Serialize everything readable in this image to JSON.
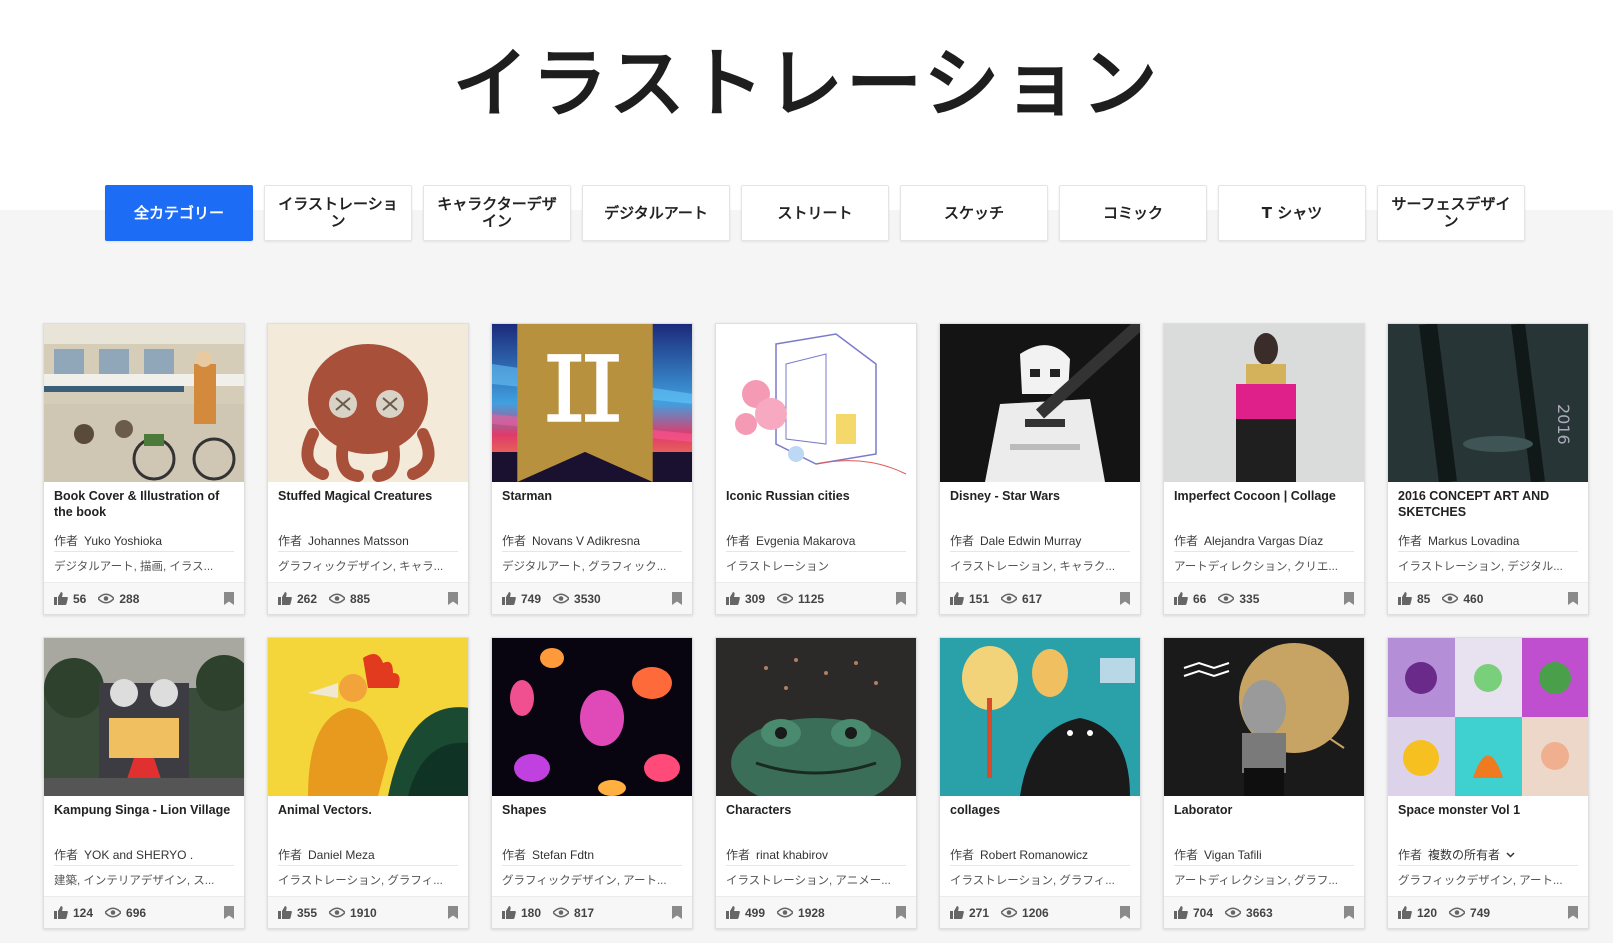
{
  "page": {
    "title": "イラストレーション",
    "author_label": "作者"
  },
  "categories": [
    {
      "label": "全カテゴリー",
      "active": true
    },
    {
      "label": "イラストレーション",
      "active": false
    },
    {
      "label": "キャラクターデザイン",
      "active": false
    },
    {
      "label": "デジタルアート",
      "active": false
    },
    {
      "label": "ストリート",
      "active": false
    },
    {
      "label": "スケッチ",
      "active": false
    },
    {
      "label": "コミック",
      "active": false
    },
    {
      "label": "T シャツ",
      "active": false
    },
    {
      "label": "サーフェスデザイン",
      "active": false
    }
  ],
  "icons": {
    "like": "thumbs-up-icon",
    "views": "eye-icon",
    "save": "bookmark-icon",
    "badge": "featured-badge-icon",
    "dropdown": "chevron-down-icon"
  },
  "colors": {
    "accent": "#1d6cf6",
    "badge": "#b8913f"
  },
  "cards": [
    {
      "title": "Book Cover & Illustration of the book",
      "author": "Yuko Yoshioka",
      "tags": "デジタルアート, 描画, イラス...",
      "likes": "56",
      "views": "288",
      "art": "cafe"
    },
    {
      "title": "Stuffed Magical Creatures",
      "author": "Johannes Matsson",
      "tags": "グラフィックデザイン, キャラ...",
      "likes": "262",
      "views": "885",
      "art": "creature"
    },
    {
      "title": "Starman",
      "author": "Novans V Adikresna",
      "tags": "デジタルアート, グラフィック...",
      "likes": "749",
      "views": "3530",
      "art": "starman",
      "badge": true
    },
    {
      "title": "Iconic Russian cities",
      "author": "Evgenia Makarova",
      "tags": "イラストレーション",
      "likes": "309",
      "views": "1125",
      "art": "russian"
    },
    {
      "title": "Disney - Star Wars",
      "author": "Dale Edwin Murray",
      "tags": "イラストレーション, キャラク...",
      "likes": "151",
      "views": "617",
      "art": "trooper"
    },
    {
      "title": "Imperfect Cocoon | Collage",
      "author": "Alejandra Vargas Díaz",
      "tags": "アートディレクション, クリエ...",
      "likes": "66",
      "views": "335",
      "art": "cocoon"
    },
    {
      "title": "2016 CONCEPT ART AND SKETCHES",
      "author": "Markus Lovadina",
      "tags": "イラストレーション, デジタル...",
      "likes": "85",
      "views": "460",
      "art": "concept"
    },
    {
      "title": "Kampung Singa - Lion Village",
      "author": "YOK and SHERYO .",
      "tags": "建築, インテリアデザイン, ス...",
      "likes": "124",
      "views": "696",
      "art": "kampung"
    },
    {
      "title": "Animal Vectors.",
      "author": "Daniel Meza",
      "tags": "イラストレーション, グラフィ...",
      "likes": "355",
      "views": "1910",
      "art": "rooster"
    },
    {
      "title": "Shapes",
      "author": "Stefan Fdtn",
      "tags": "グラフィックデザイン, アート...",
      "likes": "180",
      "views": "817",
      "art": "shapes"
    },
    {
      "title": "Characters",
      "author": "rinat khabirov",
      "tags": "イラストレーション, アニメー...",
      "likes": "499",
      "views": "1928",
      "art": "frog"
    },
    {
      "title": "collages",
      "author": "Robert Romanowicz",
      "tags": "イラストレーション, グラフィ...",
      "likes": "271",
      "views": "1206",
      "art": "collage"
    },
    {
      "title": "Laborator",
      "author": "Vigan Tafili",
      "tags": "アートディレクション, グラフ...",
      "likes": "704",
      "views": "3663",
      "art": "laborator"
    },
    {
      "title": "Space monster Vol 1",
      "author": "複数の所有者",
      "tags": "グラフィックデザイン, アート...",
      "likes": "120",
      "views": "749",
      "art": "monsters",
      "dropdown": true
    }
  ]
}
